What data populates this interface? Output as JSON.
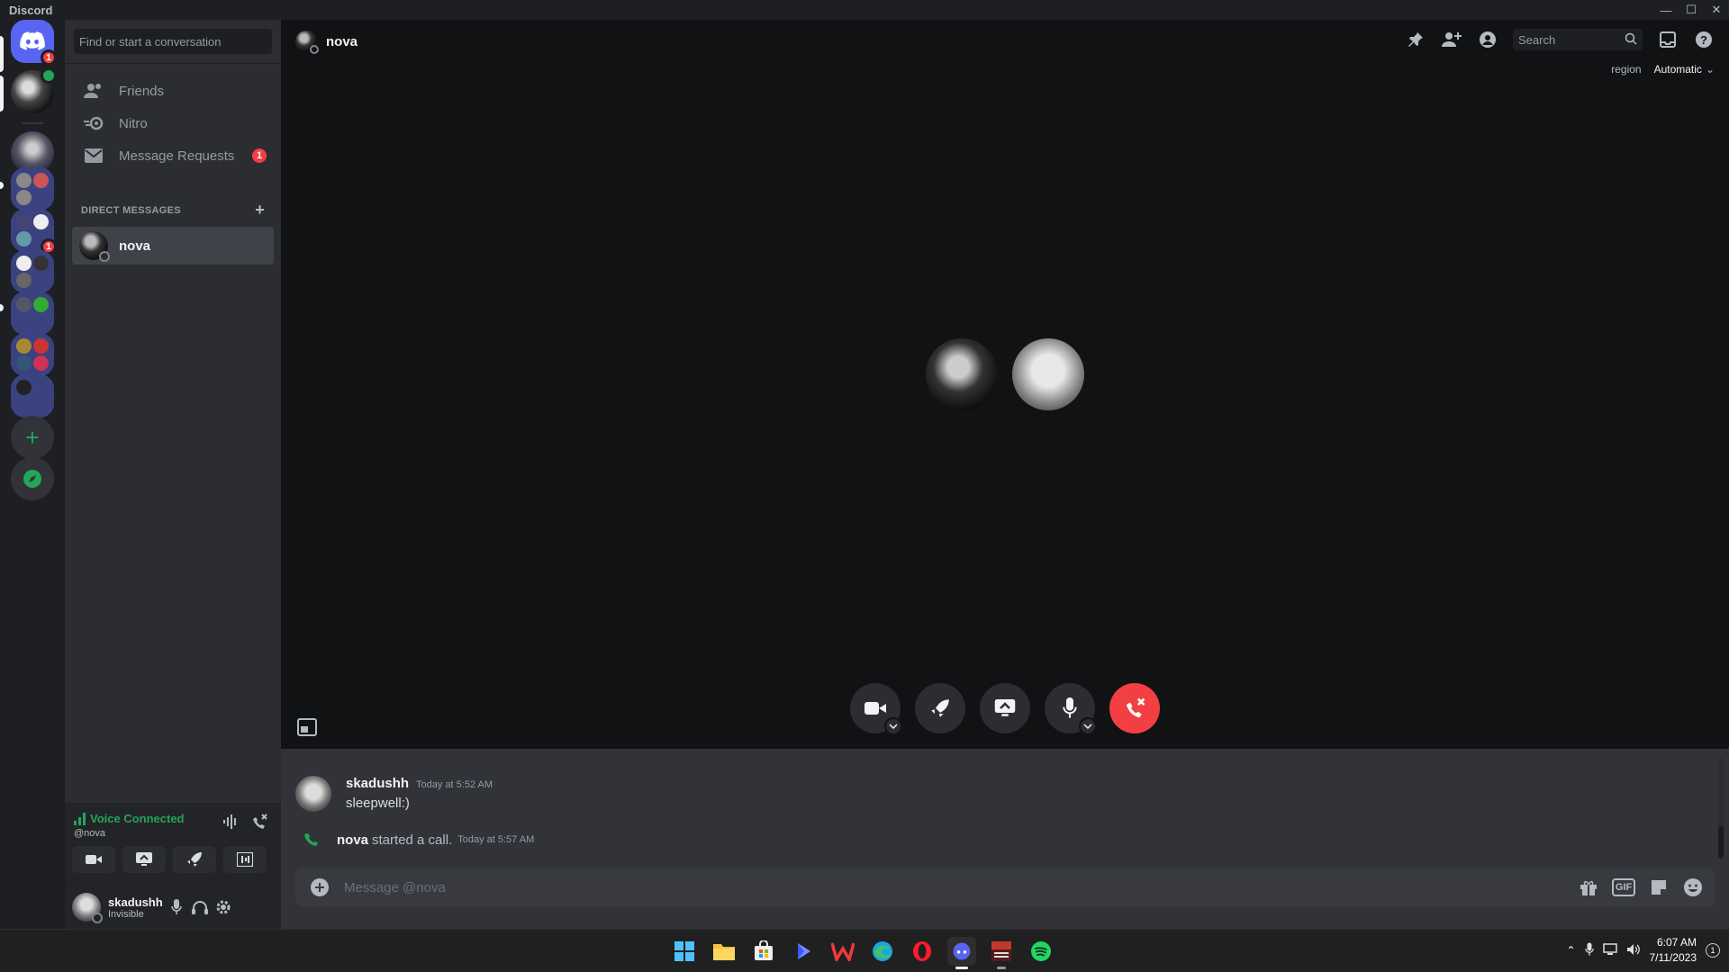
{
  "window": {
    "title": "Discord"
  },
  "guilds": {
    "home_badge": "1",
    "badge_2": "1",
    "add_server_label": "+"
  },
  "sidebar": {
    "search_placeholder": "Find or start a conversation",
    "nav": [
      {
        "label": "Friends",
        "icon": "friends-icon"
      },
      {
        "label": "Nitro",
        "icon": "nitro-icon"
      },
      {
        "label": "Message Requests",
        "icon": "mail-icon",
        "count": "1"
      }
    ],
    "dm_header": "DIRECT MESSAGES",
    "dm_add": "+",
    "dms": [
      {
        "name": "nova"
      }
    ]
  },
  "voice": {
    "status": "Voice Connected",
    "channel": "@nova"
  },
  "user": {
    "name": "skadushh",
    "status": "Invisible"
  },
  "call": {
    "title": "nova",
    "search_placeholder": "Search",
    "region_label": "region",
    "region_value": "Automatic"
  },
  "chat": {
    "messages": [
      {
        "author": "skadushh",
        "timestamp": "Today at 5:52 AM",
        "text": "sleepwell:)"
      }
    ],
    "system": {
      "name": "nova",
      "text": "started a call.",
      "timestamp": "Today at 5:57 AM"
    },
    "composer_placeholder": "Message @nova",
    "gif_label": "GIF"
  },
  "taskbar": {
    "time": "6:07 AM",
    "date": "7/11/2023",
    "notifications": "1"
  },
  "colors": {
    "accent": "#5865f2",
    "danger": "#f23f43",
    "online": "#23a55a"
  }
}
